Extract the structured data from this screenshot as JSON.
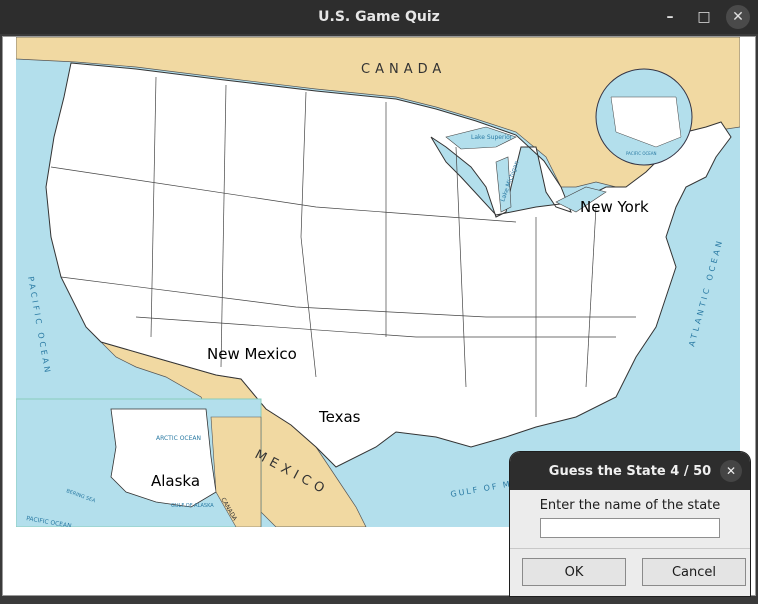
{
  "window": {
    "title": "U.S. Game Quiz",
    "controls": {
      "minimize": "–",
      "maximize": "□",
      "close": "✕"
    }
  },
  "map": {
    "labels": {
      "canada": "CANADA",
      "mexico": "MEXICO",
      "pacific_ocean": "PACIFIC OCEAN",
      "atlantic_ocean": "ATLANTIC OCEAN",
      "gulf_of_mexico": "GULF OF ME",
      "lake_superior": "Lake Superior",
      "lake_michigan": "Lake Michigan",
      "arctic_ocean": "ARCTIC OCEAN",
      "bering_sea": "BERING SEA",
      "gulf_of_alaska": "GULF OF ALASKA",
      "inset_canada": "CANADA",
      "inset_pacific": "PACIFIC OCEAN",
      "globe_pacific": "PACIFIC OCEAN"
    },
    "guessed_states": [
      "New York",
      "New Mexico",
      "Texas",
      "Alaska"
    ],
    "colors": {
      "water": "#b3dfec",
      "land_foreign": "#f1d9a2",
      "states": "#ffffff",
      "borders": "#333333"
    }
  },
  "dialog": {
    "title": "Guess the State 4 / 50",
    "prompt": "Enter the name of the state",
    "input_value": "",
    "ok_label": "OK",
    "cancel_label": "Cancel",
    "close": "✕"
  }
}
